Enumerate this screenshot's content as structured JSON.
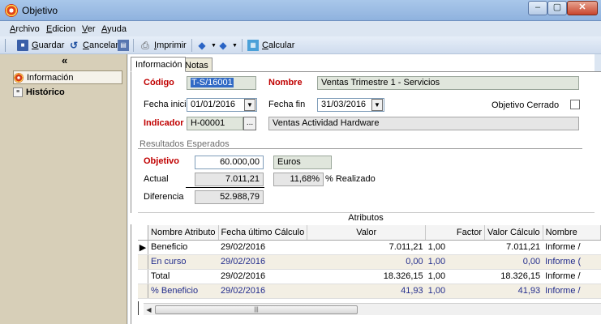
{
  "window": {
    "title": "Objetivo"
  },
  "menu": [
    "Archivo",
    "Edicion",
    "Ver",
    "Ayuda"
  ],
  "toolbar": {
    "guardar": "Guardar",
    "cancelar": "Cancelar",
    "imprimir": "Imprimir",
    "calcular": "Calcular"
  },
  "sidebar": {
    "collapse": "«",
    "items": [
      {
        "label": "Información"
      },
      {
        "label": "Histórico"
      }
    ]
  },
  "tabs": [
    "Información",
    "Notas"
  ],
  "form": {
    "codigo_label": "Código",
    "codigo_value": "T-S/16001",
    "nombre_label": "Nombre",
    "nombre_value": "Ventas Trimestre 1 - Servicios",
    "fecha_inicio_label": "Fecha inicio",
    "fecha_inicio_value": "01/01/2016",
    "fecha_fin_label": "Fecha fin",
    "fecha_fin_value": "31/03/2016",
    "objetivo_cerrado_label": "Objetivo Cerrado",
    "indicador_label": "Indicador",
    "indicador_code": "H-00001",
    "indicador_btn": "...",
    "indicador_desc": "Ventas Actividad Hardware"
  },
  "resultados": {
    "section_label": "Resultados Esperados",
    "objetivo_label": "Objetivo",
    "objetivo_value": "60.000,00",
    "unidad": "Euros",
    "actual_label": "Actual",
    "actual_value": "7.011,21",
    "pct_value": "11,68%",
    "pct_label": "% Realizado",
    "diferencia_label": "Diferencia",
    "diferencia_value": "52.988,79"
  },
  "atributos": {
    "title": "Atributos",
    "columns": [
      "Nombre Atributo",
      "Fecha último Cálculo",
      "Valor",
      "Factor",
      "Valor Cálculo",
      "Nombre"
    ],
    "rows": [
      [
        "Beneficio",
        "29/02/2016",
        "7.011,21",
        "1,00",
        "7.011,21",
        "Informe /"
      ],
      [
        "En curso",
        "29/02/2016",
        "0,00",
        "1,00",
        "0,00",
        "Informe ("
      ],
      [
        "Total",
        "29/02/2016",
        "18.326,15",
        "1,00",
        "18.326,15",
        "Informe /"
      ],
      [
        "% Beneficio",
        "29/02/2016",
        "41,93",
        "1,00",
        "41,93",
        "Informe /"
      ]
    ]
  }
}
